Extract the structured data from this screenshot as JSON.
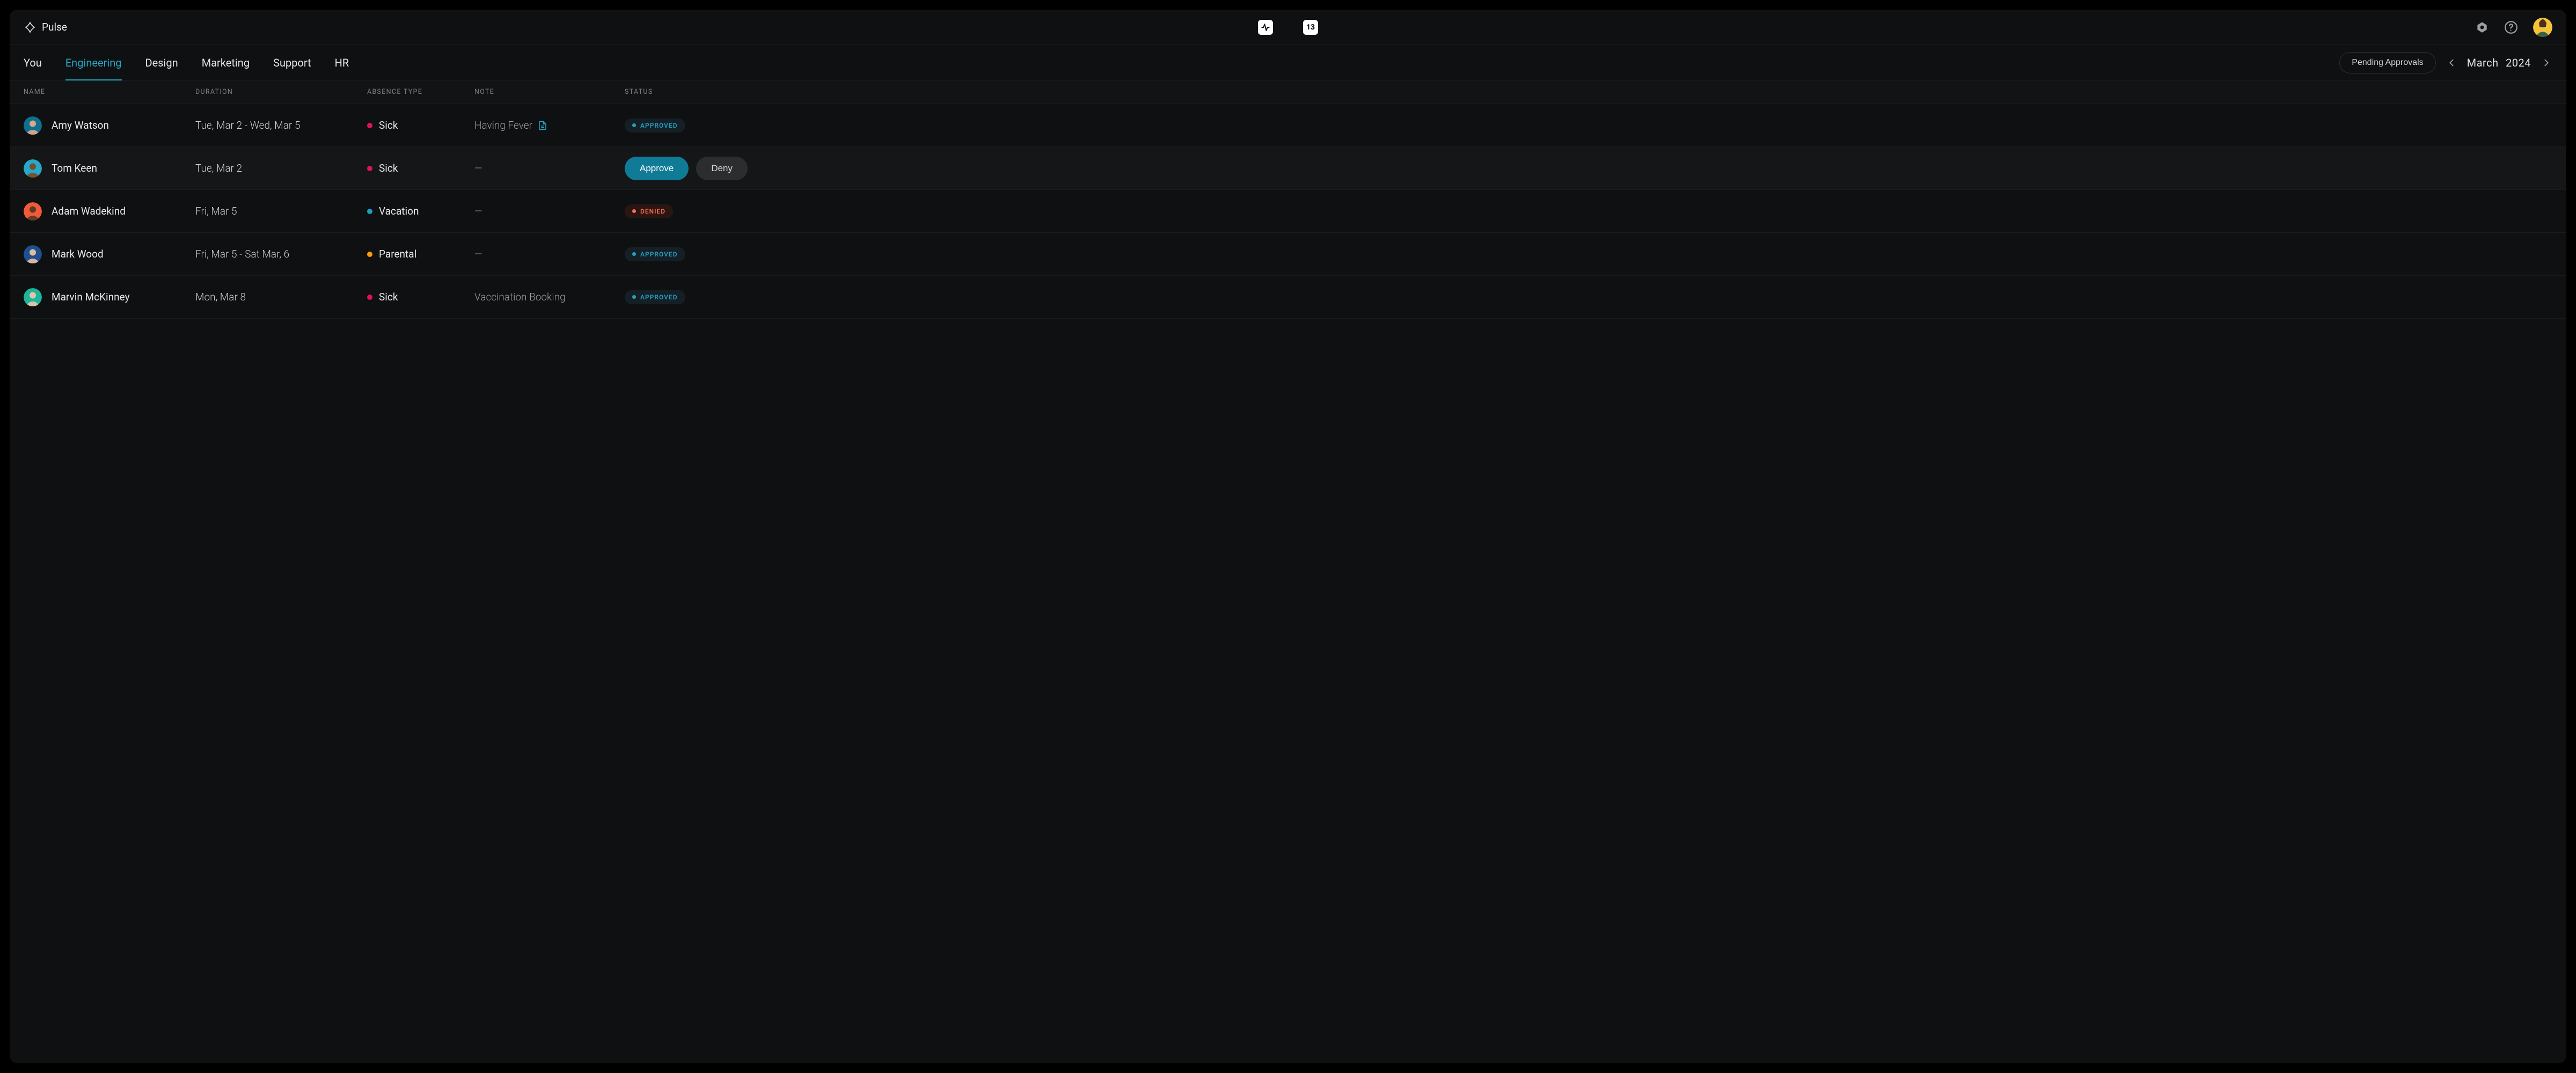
{
  "app": {
    "name": "Pulse"
  },
  "topbar": {
    "calendar_badge": "13"
  },
  "tabs": {
    "items": [
      {
        "label": "You",
        "active": false
      },
      {
        "label": "Engineering",
        "active": true
      },
      {
        "label": "Design",
        "active": false
      },
      {
        "label": "Marketing",
        "active": false
      },
      {
        "label": "Support",
        "active": false
      },
      {
        "label": "HR",
        "active": false
      }
    ]
  },
  "toolbar": {
    "pending_label": "Pending Approvals",
    "period_month": "March",
    "period_year": "2024"
  },
  "table": {
    "columns": {
      "name": "NAME",
      "duration": "DURATION",
      "type": "ABSENCE TYPE",
      "note": "NOTE",
      "status": "STATUS"
    },
    "rows": [
      {
        "name": "Amy Watson",
        "duration": "Tue, Mar 2 -  Wed, Mar 5",
        "absence_type": "Sick",
        "absence_key": "sick",
        "note": "Having Fever",
        "has_attachment": true,
        "status": "approved",
        "status_label": "APPROVED",
        "avatar_bg": "#0e6f8f",
        "avatar_skin": "#d7a889"
      },
      {
        "name": "Tom Keen",
        "duration": "Tue, Mar 2",
        "absence_type": "Sick",
        "absence_key": "sick",
        "note": "—",
        "has_attachment": false,
        "status": "pending",
        "approve_label": "Approve",
        "deny_label": "Deny",
        "avatar_bg": "#27a7c9",
        "avatar_skin": "#7a4d2a"
      },
      {
        "name": "Adam Wadekind",
        "duration": "Fri, Mar 5",
        "absence_type": "Vacation",
        "absence_key": "vacation",
        "note": "—",
        "has_attachment": false,
        "status": "denied",
        "status_label": "DENIED",
        "avatar_bg": "#f05a3a",
        "avatar_skin": "#5c3a23"
      },
      {
        "name": "Mark Wood",
        "duration": "Fri, Mar 5 -  Sat Mar, 6",
        "absence_type": "Parental",
        "absence_key": "parental",
        "note": "—",
        "has_attachment": false,
        "status": "approved",
        "status_label": "APPROVED",
        "avatar_bg": "#1f4f8f",
        "avatar_skin": "#e3bda2"
      },
      {
        "name": "Marvin McKinney",
        "duration": "Mon, Mar 8",
        "absence_type": "Sick",
        "absence_key": "sick",
        "note": "Vaccination Booking",
        "has_attachment": false,
        "status": "approved",
        "status_label": "APPROVED",
        "avatar_bg": "#1fb59a",
        "avatar_skin": "#e3c5ab"
      }
    ]
  },
  "colors": {
    "accent": "#27a7c9",
    "approved": "#24a0c2",
    "denied": "#f76f54",
    "sick": "#e0115f",
    "vacation": "#1f9cbf",
    "parental": "#f59e0b"
  }
}
